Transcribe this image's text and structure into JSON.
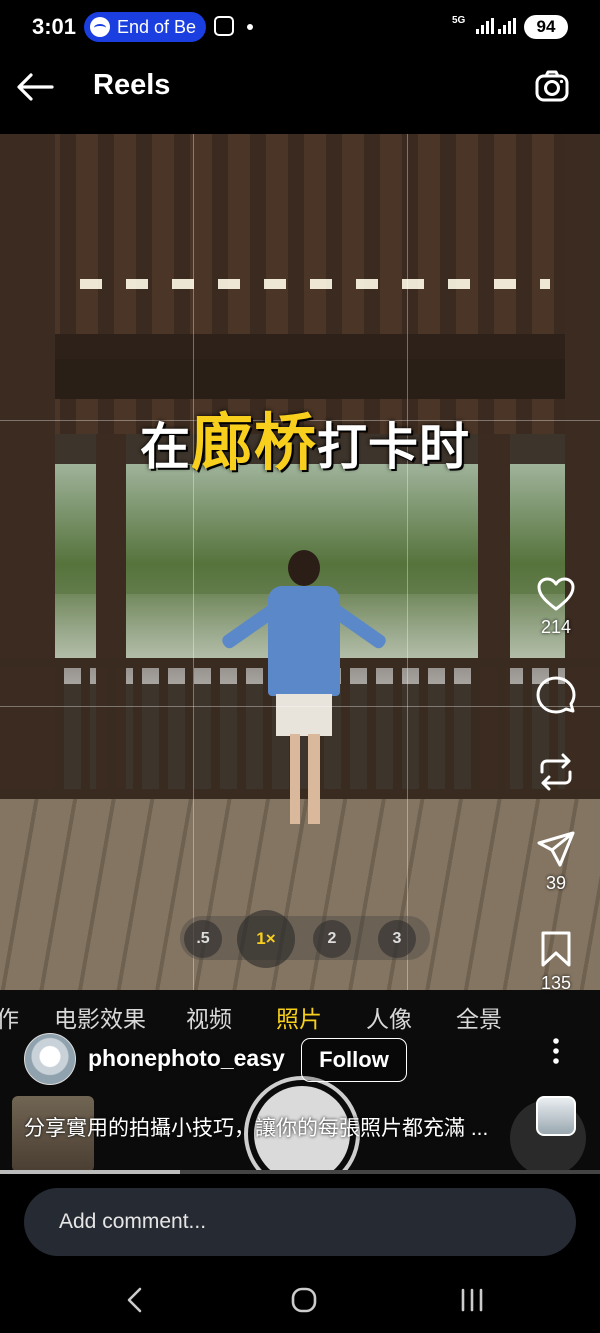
{
  "status_bar": {
    "time": "3:01",
    "media_pill_text": "End of Be",
    "network": "5G",
    "battery": "94",
    "icons": [
      "spotify-icon",
      "screen-record-icon",
      "notification-dot",
      "signal-icon",
      "battery-icon"
    ]
  },
  "header": {
    "title": "Reels",
    "back_icon": "arrow-left-icon",
    "camera_icon": "camera-icon"
  },
  "video": {
    "overlay_caption_parts": [
      "在",
      "廊桥",
      "打卡时"
    ],
    "camera_zoom_options": [
      ".5",
      "1×",
      "2",
      "3"
    ],
    "camera_zoom_selected": "1×",
    "camera_modes": [
      "电影效果",
      "视频",
      "照片",
      "人像",
      "全景"
    ],
    "camera_mode_partial": "作",
    "camera_mode_selected": "照片",
    "progress_fraction": 0.3
  },
  "actions": {
    "like_count": "214",
    "share_count": "39",
    "save_count": "135",
    "icons": [
      "heart-icon",
      "comment-icon",
      "repost-icon",
      "send-icon",
      "bookmark-icon",
      "more-icon"
    ]
  },
  "post": {
    "username": "phonephoto_easy",
    "follow_label": "Follow",
    "caption": "分享實用的拍攝小技巧，讓你的每張照片都充滿 ..."
  },
  "comment": {
    "placeholder": "Add comment..."
  },
  "nav": {
    "icons": [
      "back-nav-icon",
      "home-nav-icon",
      "recents-nav-icon"
    ]
  },
  "colors": {
    "accent_yellow": "#f7cf1c",
    "spotify_pill": "#1a3ee0",
    "comment_bg": "#262a33"
  }
}
